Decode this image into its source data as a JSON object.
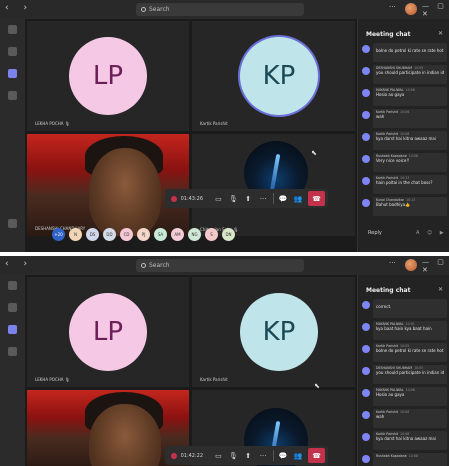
{
  "topbar": {
    "nav": "‹ ›",
    "search_placeholder": "Search",
    "more": "···",
    "window_controls": "— ▢ ✕"
  },
  "rail": {
    "labels": [
      "Activity",
      "Chat",
      "Teams",
      "Calendar",
      "Calls",
      "Files"
    ]
  },
  "meeting": {
    "participants": [
      {
        "initials": "LP",
        "name": "LEKHA POCHA 🎙"
      },
      {
        "initials": "KP",
        "name": "Kartik Parishit"
      },
      {
        "name": "DESHANSHI CHANDHARY"
      },
      {
        "name": "Chitranjan Sahu 🎙"
      }
    ],
    "controls": {
      "time_top": "01:43:26",
      "time_bottom": "01:42:22",
      "camera": "▭",
      "mic": "🎙",
      "share": "⬆",
      "more": "···",
      "chat": "💬",
      "people": "👥",
      "leave": "☎"
    },
    "roster": [
      {
        "initials": "+20",
        "color": "#2f63c6"
      },
      {
        "initials": "N",
        "color": "#f0d6b6"
      },
      {
        "initials": "DS",
        "color": "#cfd8ea"
      },
      {
        "initials": "DD",
        "color": "#d5dce8"
      },
      {
        "initials": "CD",
        "color": "#f6c8d6"
      },
      {
        "initials": "PJ",
        "color": "#f4d6c8"
      },
      {
        "initials": "SA",
        "color": "#c9ead8"
      },
      {
        "initials": "AM",
        "color": "#f3ccd6"
      },
      {
        "initials": "NG",
        "color": "#cfe8d6"
      },
      {
        "initials": "S",
        "color": "#f5c9c9"
      },
      {
        "initials": "DN",
        "color": "#d9e7c9"
      }
    ]
  },
  "chat": {
    "title": "Meeting chat",
    "close": "✕",
    "reply": "Reply",
    "tools": "A ☺ ▶",
    "messages_top": [
      {
        "who": "",
        "time": "",
        "text": "bolne do petrol ki rate se rate hot rate to lehai"
      },
      {
        "who": "DESHANSHI SHUBHAM",
        "time": "10:05",
        "text": "you should participate in indian idol"
      },
      {
        "who": "MAYANK PALIWAL",
        "time": "10:06",
        "text": "Hosio ao gaya"
      },
      {
        "who": "Kartik Parishit",
        "time": "10:06",
        "text": "wah"
      },
      {
        "who": "Kartik Parishit",
        "time": "10:08",
        "text": "kya darst hai kitna awaaz mai"
      },
      {
        "who": "Rushabh Kapadane",
        "time": "10:08",
        "text": "Very nice voice!!"
      },
      {
        "who": "Kartik Parishit",
        "time": "10:13",
        "text": "hain poltai in the chat boss?"
      },
      {
        "who": "Kunal Chandolkar",
        "time": "10:13",
        "text": "Bahut badhiya👍"
      }
    ],
    "messages_bottom": [
      {
        "who": "",
        "time": "",
        "text": "correct."
      },
      {
        "who": "MAYANK PALIWAL",
        "time": "10:01",
        "text": "kya baat hain kya baat hain"
      },
      {
        "who": "Kartik Parishit",
        "time": "10:05",
        "text": "bolne do petrol ki rate se rate hot rate to lehai"
      },
      {
        "who": "DESHANSHI SHUBHAM",
        "time": "10:05",
        "text": "you should participate in indian idol"
      },
      {
        "who": "MAYANK PALIWAL",
        "time": "10:06",
        "text": "Hosio ao gaya"
      },
      {
        "who": "Kartik Parishit",
        "time": "10:06",
        "text": "wah"
      },
      {
        "who": "Kartik Parishit",
        "time": "10:08",
        "text": "kya darst hai kitna awaaz mai"
      },
      {
        "who": "Rushabh Kapadane",
        "time": "10:08",
        "text": ""
      }
    ]
  }
}
